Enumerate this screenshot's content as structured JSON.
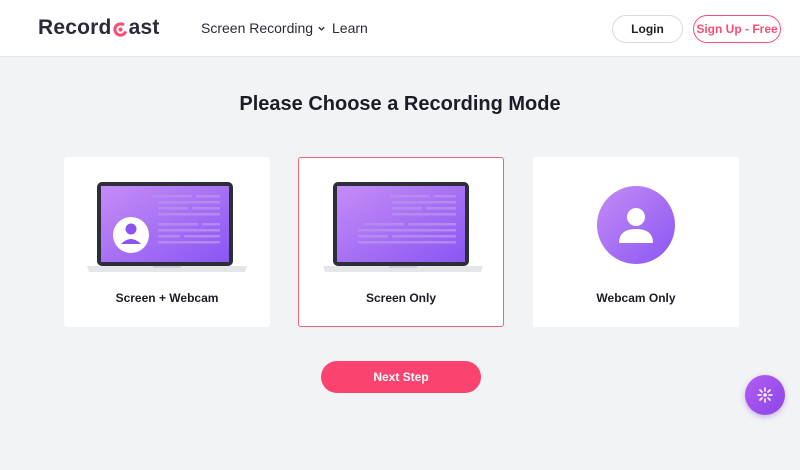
{
  "header": {
    "logo_prefix": "Record",
    "logo_suffix": "ast",
    "nav_screen_recording": "Screen Recording",
    "nav_learn": "Learn",
    "login_label": "Login",
    "signup_label": "Sign Up - Free"
  },
  "main": {
    "title": "Please Choose a Recording Mode",
    "options": [
      {
        "label": "Screen + Webcam",
        "selected": false
      },
      {
        "label": "Screen Only",
        "selected": true
      },
      {
        "label": "Webcam Only",
        "selected": false
      }
    ],
    "next_label": "Next Step"
  },
  "icons": {
    "logo_mark": "record-c-icon",
    "nav_chevron": "chevron-down-icon",
    "screen_webcam": "laptop-with-avatar-icon",
    "screen_only": "laptop-icon",
    "webcam_only": "user-avatar-icon",
    "fab": "sparkle-icon"
  },
  "colors": {
    "accent": "#fa4d74",
    "purple_start": "#c58cf6",
    "purple_end": "#8a56f3",
    "background": "#f2f3f5"
  }
}
